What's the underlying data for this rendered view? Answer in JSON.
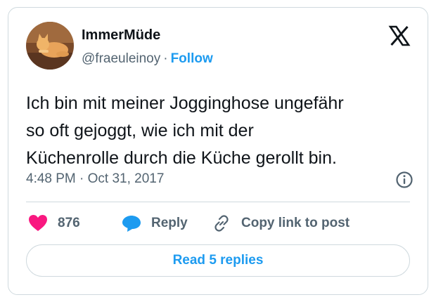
{
  "author": {
    "display_name": "ImmerMüde",
    "handle": "@fraeuleinoy",
    "separator": "·",
    "follow_label": "Follow"
  },
  "tweet": {
    "text_lines": [
      "Ich bin mit meiner Jogginghose ungefähr",
      "so oft gejoggt, wie ich mit der",
      "Küchenrolle durch die Küche gerollt bin."
    ],
    "timestamp": "4:48 PM · Oct 31, 2017"
  },
  "actions": {
    "like_count": "876",
    "reply_label": "Reply",
    "copy_link_label": "Copy link to post"
  },
  "footer": {
    "read_replies_label": "Read 5 replies"
  },
  "icons": {
    "logo": "x-logo-icon",
    "info": "info-icon",
    "like": "heart-icon",
    "reply": "speech-bubble-icon",
    "copy": "link-icon"
  },
  "colors": {
    "accent": "#1d9bf0",
    "heart": "#f91880",
    "secondary_text": "#536471",
    "border": "#cfd9de"
  }
}
